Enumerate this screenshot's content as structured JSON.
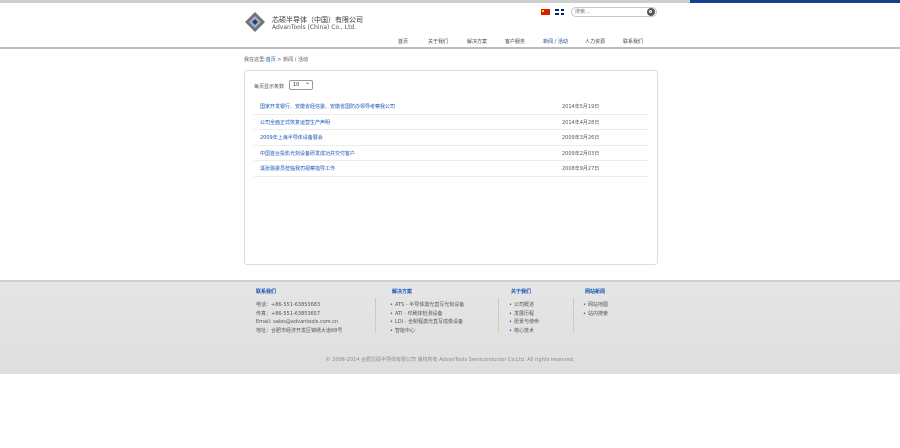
{
  "header": {
    "brand_cn": "芯硕半导体（中国）有限公司",
    "brand_en": "AdvanTools (China) Co., Ltd.",
    "search_placeholder": "搜索...",
    "nav": [
      "首页",
      "关于我们",
      "解决方案",
      "客户服务",
      "新闻 / 活动",
      "人力资源",
      "联系我们"
    ],
    "active_nav": "新闻 / 活动",
    "accent_color": "#1a3f8c"
  },
  "breadcrumb": {
    "prefix": "我在这里:",
    "home": "首页",
    "sep": " > ",
    "current": "新闻 / 活动"
  },
  "panel": {
    "perpage_label": "每页显示条数",
    "perpage_value": "10",
    "news": [
      {
        "title": "国家开发银行、安徽省经信委、安徽省国防办领导考察我公司",
        "date": "2014年5月19日"
      },
      {
        "title": "公司全面正式恢复运营生产声明",
        "date": "2014年4月28日"
      },
      {
        "title": "2009年上海半导体设备展会",
        "date": "2009年3月26日"
      },
      {
        "title": "中国首台投影光刻设备研发成功并交付客户",
        "date": "2009年2月03日"
      },
      {
        "title": "溪张融委员莅临我司视察指导工作",
        "date": "2008年9月27日"
      }
    ]
  },
  "footer": {
    "contact": {
      "title": "联系我们",
      "phone": "电话：+86-551-63853683",
      "fax": "传真：+86-551-63853657",
      "email": "Email: sales@advantools.com.cn",
      "address": "地址：合肥市经济开发区锦绣大道68号"
    },
    "solutions": {
      "title": "解决方案",
      "items": [
        "ATS - 半导体激光直写光刻设备",
        "ATI - 印刷体检测设备",
        "LDI - 全制程激光直写成像设备",
        "智能中心"
      ]
    },
    "about": {
      "title": "关于我们",
      "items": [
        "公司概述",
        "发展历程",
        "愿景与使命",
        "核心技术"
      ]
    },
    "site": {
      "title": "网站新闻",
      "items": [
        "网站地图",
        "站内搜索"
      ]
    },
    "copyright": "© 2006-2014 合肥芯硕半导体有限公司 版权所有 AdvanTools Semiconductor Co.Ltd. All rights reserved."
  }
}
